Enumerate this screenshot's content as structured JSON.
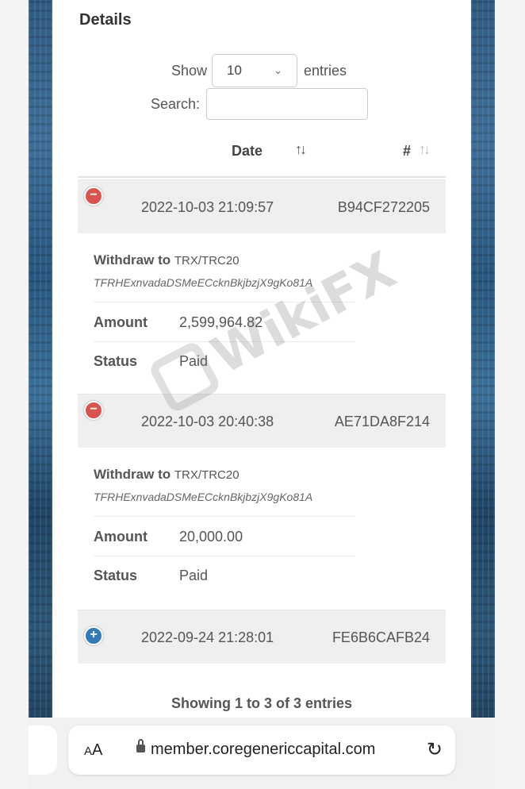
{
  "details": {
    "title": "Details",
    "show_label": "Show",
    "entries_value": "10",
    "entries_label": "entries",
    "search_label": "Search:",
    "search_value": ""
  },
  "table": {
    "columns": {
      "date": "Date",
      "date_sort": "↑↓",
      "num": "#",
      "num_sort": "↑↓"
    },
    "rows": [
      {
        "toggle": "−",
        "date": "2022-10-03 21:09:57",
        "id": "B94CF272205",
        "withdraw_label": "Withdraw to",
        "network": "TRX/TRC20",
        "address": "TFRHExnvadaDSMeECcknBkjbzjX9gKo81A",
        "amount_label": "Amount",
        "amount": "2,599,964.82",
        "status_label": "Status",
        "status": "Paid"
      },
      {
        "toggle": "−",
        "date": "2022-10-03 20:40:38",
        "id": "AE71DA8F214",
        "withdraw_label": "Withdraw to",
        "network": "TRX/TRC20",
        "address": "TFRHExnvadaDSMeECcknBkjbzjX9gKo81A",
        "amount_label": "Amount",
        "amount": "20,000.00",
        "status_label": "Status",
        "status": "Paid"
      },
      {
        "toggle": "+",
        "date": "2022-09-24 21:28:01",
        "id": "FE6B6CAFB24"
      }
    ],
    "footer": "Showing 1 to 3 of 3 entries"
  },
  "watermark": {
    "text": "WikiFX"
  },
  "browser": {
    "aa_small": "A",
    "aa_big": "A",
    "url": "member.coregenericcapital.com",
    "reload_icon": "↻"
  }
}
